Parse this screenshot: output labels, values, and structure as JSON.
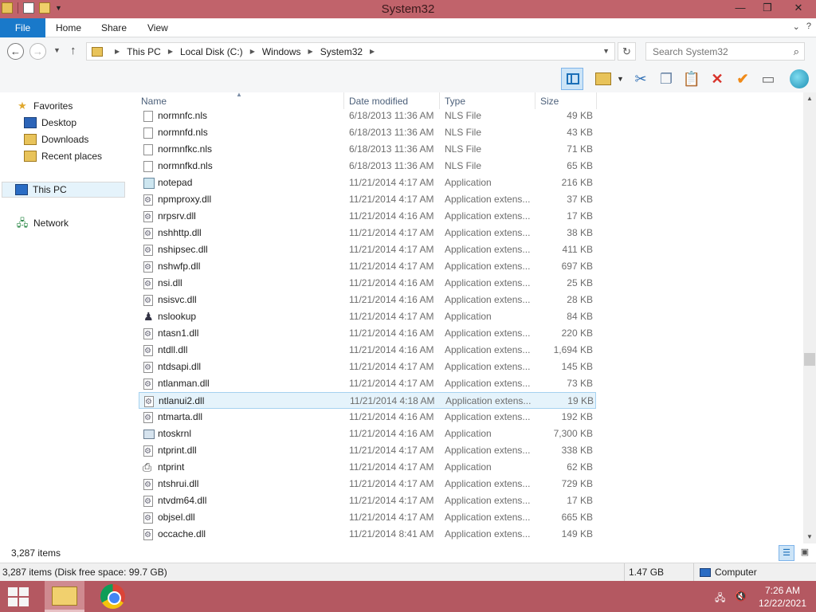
{
  "window": {
    "title": "System32"
  },
  "ribbon": {
    "tabs": [
      "File",
      "Home",
      "Share",
      "View"
    ]
  },
  "address": {
    "crumbs": [
      "This PC",
      "Local Disk (C:)",
      "Windows",
      "System32"
    ]
  },
  "search": {
    "placeholder": "Search System32"
  },
  "nav": {
    "favorites": "Favorites",
    "desktop": "Desktop",
    "downloads": "Downloads",
    "recent": "Recent places",
    "this_pc": "This PC",
    "network": "Network"
  },
  "columns": {
    "name": "Name",
    "date": "Date modified",
    "type": "Type",
    "size": "Size"
  },
  "files": [
    {
      "name": "normnfc.nls",
      "date": "6/18/2013 11:36 AM",
      "type": "NLS File",
      "size": "49 KB",
      "icon": "file"
    },
    {
      "name": "normnfd.nls",
      "date": "6/18/2013 11:36 AM",
      "type": "NLS File",
      "size": "43 KB",
      "icon": "file"
    },
    {
      "name": "normnfkc.nls",
      "date": "6/18/2013 11:36 AM",
      "type": "NLS File",
      "size": "71 KB",
      "icon": "file"
    },
    {
      "name": "normnfkd.nls",
      "date": "6/18/2013 11:36 AM",
      "type": "NLS File",
      "size": "65 KB",
      "icon": "file"
    },
    {
      "name": "notepad",
      "date": "11/21/2014 4:17 AM",
      "type": "Application",
      "size": "216 KB",
      "icon": "note"
    },
    {
      "name": "npmproxy.dll",
      "date": "11/21/2014 4:17 AM",
      "type": "Application extens...",
      "size": "37 KB",
      "icon": "dll"
    },
    {
      "name": "nrpsrv.dll",
      "date": "11/21/2014 4:16 AM",
      "type": "Application extens...",
      "size": "17 KB",
      "icon": "dll"
    },
    {
      "name": "nshhttp.dll",
      "date": "11/21/2014 4:17 AM",
      "type": "Application extens...",
      "size": "38 KB",
      "icon": "dll"
    },
    {
      "name": "nshipsec.dll",
      "date": "11/21/2014 4:17 AM",
      "type": "Application extens...",
      "size": "411 KB",
      "icon": "dll"
    },
    {
      "name": "nshwfp.dll",
      "date": "11/21/2014 4:17 AM",
      "type": "Application extens...",
      "size": "697 KB",
      "icon": "dll"
    },
    {
      "name": "nsi.dll",
      "date": "11/21/2014 4:16 AM",
      "type": "Application extens...",
      "size": "25 KB",
      "icon": "dll"
    },
    {
      "name": "nsisvc.dll",
      "date": "11/21/2014 4:16 AM",
      "type": "Application extens...",
      "size": "28 KB",
      "icon": "dll"
    },
    {
      "name": "nslookup",
      "date": "11/21/2014 4:17 AM",
      "type": "Application",
      "size": "84 KB",
      "icon": "ns"
    },
    {
      "name": "ntasn1.dll",
      "date": "11/21/2014 4:16 AM",
      "type": "Application extens...",
      "size": "220 KB",
      "icon": "dll"
    },
    {
      "name": "ntdll.dll",
      "date": "11/21/2014 4:16 AM",
      "type": "Application extens...",
      "size": "1,694 KB",
      "icon": "dll"
    },
    {
      "name": "ntdsapi.dll",
      "date": "11/21/2014 4:17 AM",
      "type": "Application extens...",
      "size": "145 KB",
      "icon": "dll"
    },
    {
      "name": "ntlanman.dll",
      "date": "11/21/2014 4:17 AM",
      "type": "Application extens...",
      "size": "73 KB",
      "icon": "dll"
    },
    {
      "name": "ntlanui2.dll",
      "date": "11/21/2014 4:18 AM",
      "type": "Application extens...",
      "size": "19 KB",
      "icon": "dll",
      "selected": true
    },
    {
      "name": "ntmarta.dll",
      "date": "11/21/2014 4:16 AM",
      "type": "Application extens...",
      "size": "192 KB",
      "icon": "dll"
    },
    {
      "name": "ntoskrnl",
      "date": "11/21/2014 4:16 AM",
      "type": "Application",
      "size": "7,300 KB",
      "icon": "app"
    },
    {
      "name": "ntprint.dll",
      "date": "11/21/2014 4:17 AM",
      "type": "Application extens...",
      "size": "338 KB",
      "icon": "dll"
    },
    {
      "name": "ntprint",
      "date": "11/21/2014 4:17 AM",
      "type": "Application",
      "size": "62 KB",
      "icon": "printer"
    },
    {
      "name": "ntshrui.dll",
      "date": "11/21/2014 4:17 AM",
      "type": "Application extens...",
      "size": "729 KB",
      "icon": "dll"
    },
    {
      "name": "ntvdm64.dll",
      "date": "11/21/2014 4:17 AM",
      "type": "Application extens...",
      "size": "17 KB",
      "icon": "dll"
    },
    {
      "name": "objsel.dll",
      "date": "11/21/2014 4:17 AM",
      "type": "Application extens...",
      "size": "665 KB",
      "icon": "dll"
    },
    {
      "name": "occache.dll",
      "date": "11/21/2014 8:41 AM",
      "type": "Application extens...",
      "size": "149 KB",
      "icon": "dll"
    }
  ],
  "status": {
    "item_count": "3,287 items",
    "details": "3,287 items (Disk free space: 99.7 GB)",
    "selection_size": "1.47 GB",
    "location": "Computer"
  },
  "taskbar": {
    "time": "7:26 AM",
    "date": "12/22/2021"
  },
  "colors": {
    "titlebar": "#c1636b",
    "taskbar": "#b45861",
    "file_tab": "#1979ca",
    "selection": "#e5f3fb"
  }
}
